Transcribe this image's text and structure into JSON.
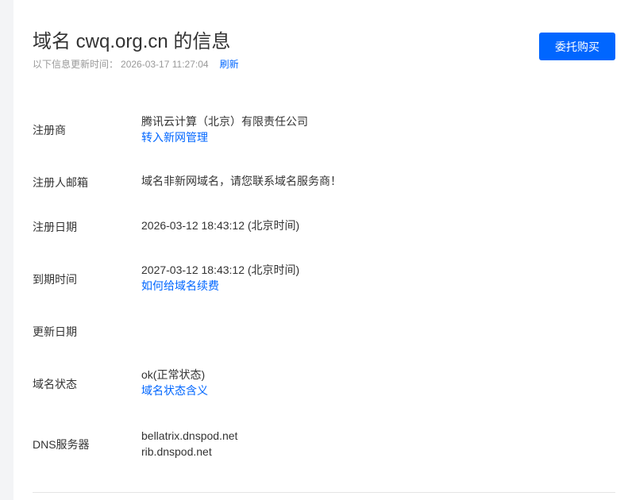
{
  "header": {
    "title": "域名 cwq.org.cn 的信息",
    "updated_label": "以下信息更新时间：",
    "updated_time": "2026-03-17 11:27:04",
    "refresh_label": "刷新",
    "buy_button": "委托购买"
  },
  "rows": {
    "registrar": {
      "label": "注册商",
      "value": "腾讯云计算（北京）有限责任公司",
      "link": "转入新网管理"
    },
    "email": {
      "label": "注册人邮箱",
      "value": "域名非新网域名，请您联系域名服务商！"
    },
    "reg_date": {
      "label": "注册日期",
      "value": "2026-03-12 18:43:12 (北京时间)"
    },
    "expiry": {
      "label": "到期时间",
      "value": "2027-03-12 18:43:12 (北京时间)",
      "link": "如何给域名续费"
    },
    "updated_date": {
      "label": "更新日期",
      "value": ""
    },
    "status": {
      "label": "域名状态",
      "value": "ok(正常状态)",
      "link": "域名状态含义"
    },
    "dns": {
      "label": "DNS服务器",
      "servers": [
        "bellatrix.dnspod.net",
        "rib.dnspod.net"
      ]
    }
  },
  "colors": {
    "accent": "#0066ff",
    "text": "#333333",
    "muted": "#999999",
    "background": "#f3f4f6"
  }
}
